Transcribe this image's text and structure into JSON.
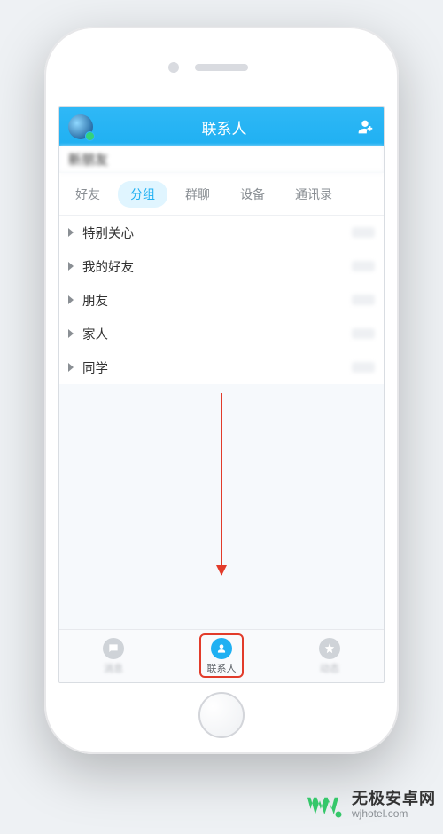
{
  "header": {
    "title": "联系人"
  },
  "newfriend_label": "新朋友",
  "tabs": {
    "t0": "好友",
    "t1": "分组",
    "t2": "群聊",
    "t3": "设备",
    "t4": "通讯录"
  },
  "groups": {
    "g0": "特别关心",
    "g1": "我的好友",
    "g2": "朋友",
    "g3": "家人",
    "g4": "同学"
  },
  "bottomnav": {
    "n0": "消息",
    "n1": "联系人",
    "n2": "动态"
  },
  "watermark": {
    "line1": "无极安卓网",
    "line2": "wjhotel.com"
  }
}
